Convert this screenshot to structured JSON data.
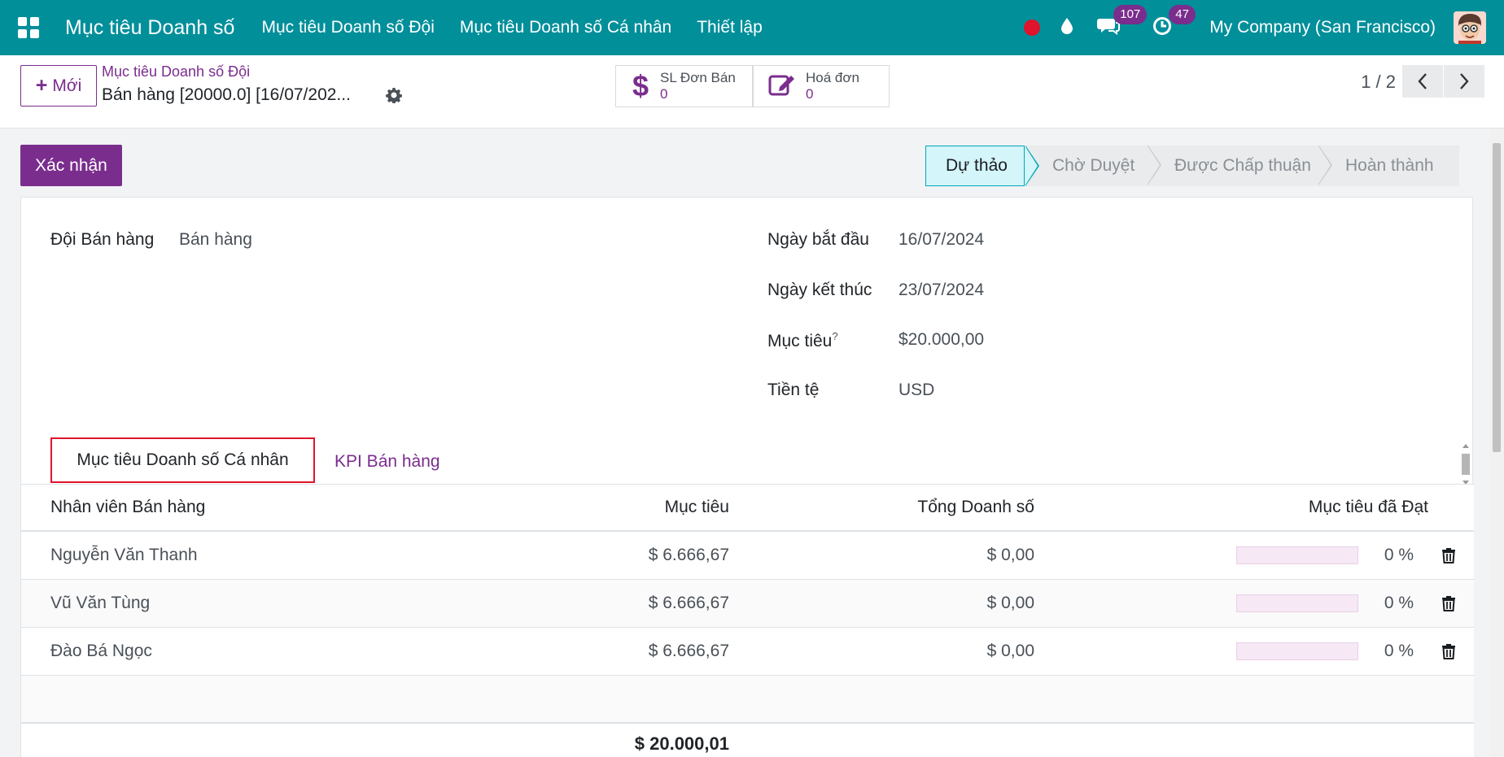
{
  "navbar": {
    "brand": "Mục tiêu Doanh số",
    "menus": [
      "Mục tiêu Doanh số Đội",
      "Mục tiêu Doanh số Cá nhân",
      "Thiết lập"
    ],
    "chat_badge": "107",
    "activity_badge": "47",
    "company": "My Company (San Francisco)"
  },
  "control": {
    "new_button": "Mới",
    "breadcrumb_parent": "Mục tiêu Doanh số Đội",
    "breadcrumb_current": "Bán hàng [20000.0] [16/07/202...",
    "stat_orders_label": "SL Đơn Bán",
    "stat_orders_value": "0",
    "stat_invoice_label": "Hoá đơn",
    "stat_invoice_value": "0",
    "pager": "1 / 2"
  },
  "actions": {
    "confirm": "Xác nhận"
  },
  "status": {
    "stages": [
      "Dự thảo",
      "Chờ Duyệt",
      "Được Chấp thuận",
      "Hoàn thành"
    ]
  },
  "form": {
    "team_label": "Đội Bán hàng",
    "team_value": "Bán hàng",
    "start_label": "Ngày bắt đầu",
    "start_value": "16/07/2024",
    "end_label": "Ngày kết thúc",
    "end_value": "23/07/2024",
    "target_label": "Mục tiêu",
    "target_help": "?",
    "target_value": "$20.000,00",
    "currency_label": "Tiền tệ",
    "currency_value": "USD"
  },
  "tabs": {
    "personal": "Mục tiêu Doanh số Cá nhân",
    "kpi": "KPI Bán hàng"
  },
  "table": {
    "headers": [
      "Nhân viên Bán hàng",
      "Mục tiêu",
      "Tổng Doanh số",
      "Mục tiêu đã Đạt"
    ],
    "rows": [
      {
        "name": "Nguyễn Văn Thanh",
        "target": "$ 6.666,67",
        "total": "$ 0,00",
        "achieved": "0 %",
        "progress": 0
      },
      {
        "name": "Vũ Văn Tùng",
        "target": "$ 6.666,67",
        "total": "$ 0,00",
        "achieved": "0 %",
        "progress": 0
      },
      {
        "name": "Đào Bá Ngọc",
        "target": "$ 6.666,67",
        "total": "$ 0,00",
        "achieved": "0 %",
        "progress": 0
      }
    ],
    "footer_total": "$ 20.000,01"
  }
}
